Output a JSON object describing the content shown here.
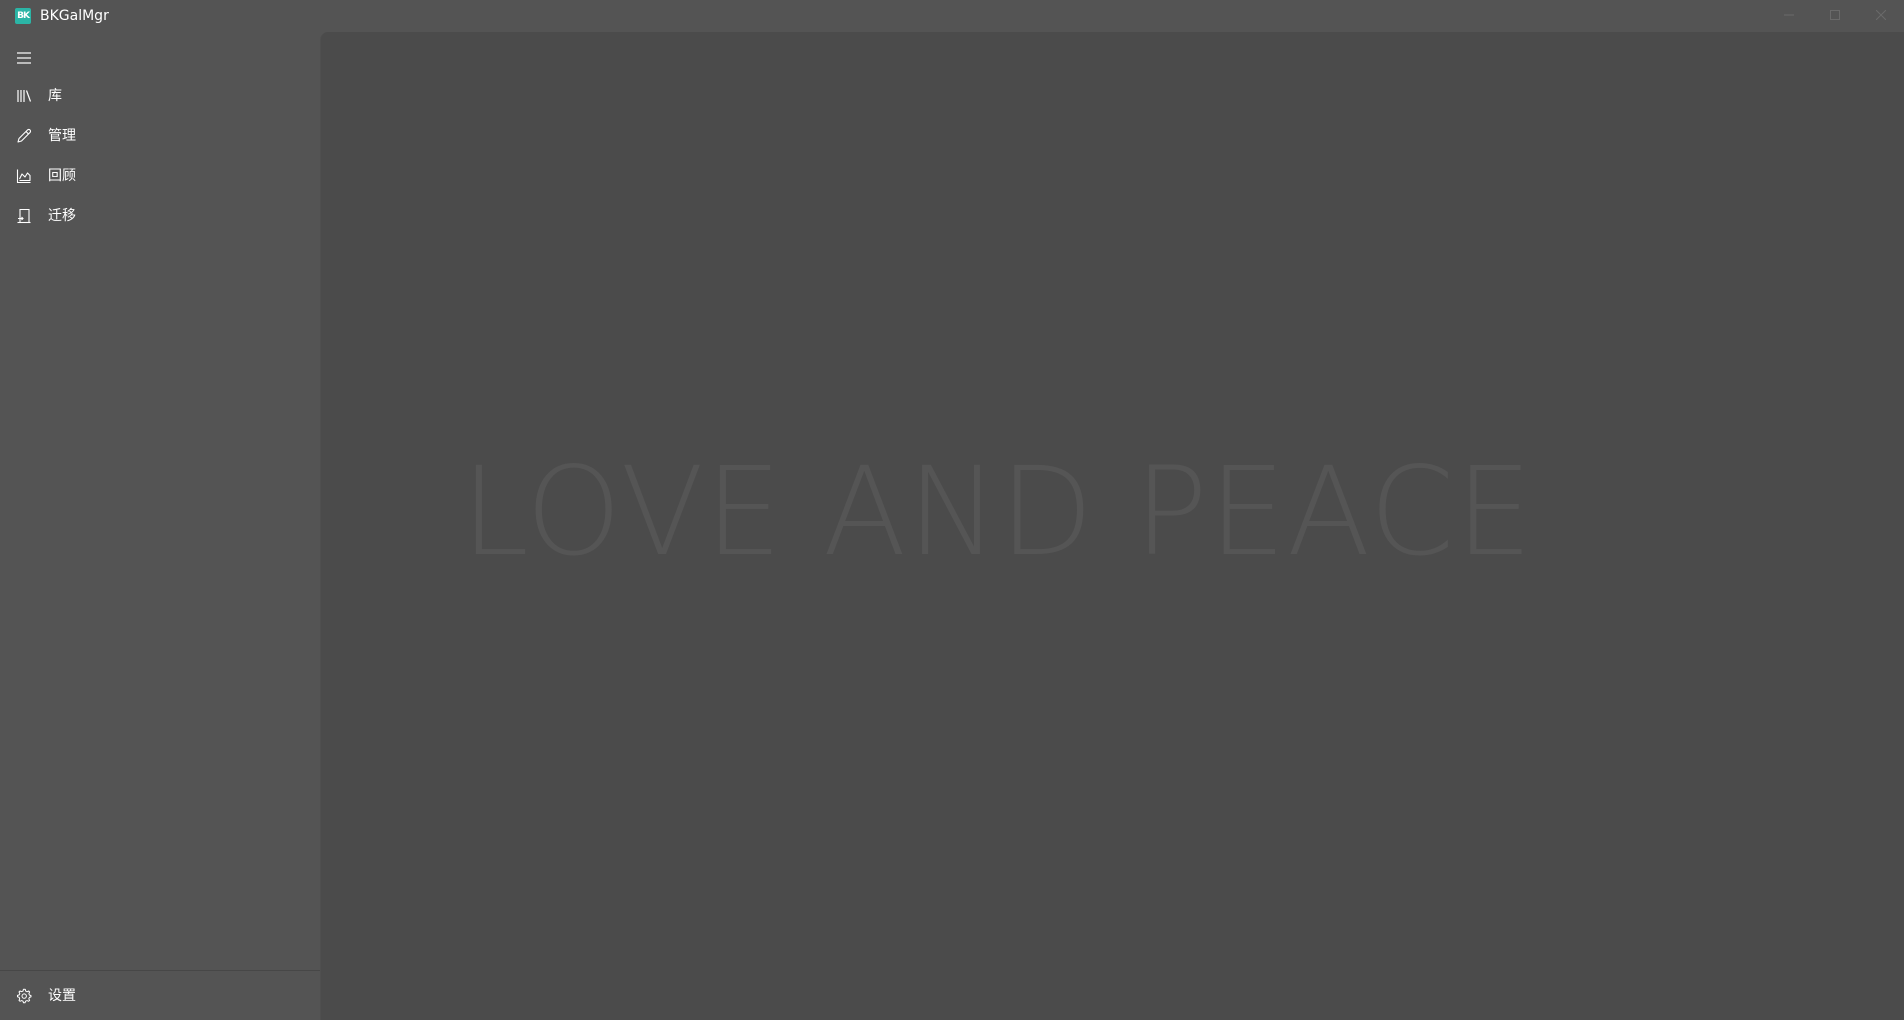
{
  "app": {
    "title": "BKGalMgr",
    "logo_text": "BK",
    "logo_color": "#2bb5a6"
  },
  "window_controls": {
    "minimize_icon": "minimize-icon",
    "maximize_icon": "maximize-icon",
    "close_icon": "close-icon"
  },
  "sidebar": {
    "toggle_icon": "hamburger-menu-icon",
    "items": [
      {
        "label": "库",
        "icon": "library-icon"
      },
      {
        "label": "管理",
        "icon": "pencil-icon"
      },
      {
        "label": "回顾",
        "icon": "area-chart-icon"
      },
      {
        "label": "迁移",
        "icon": "migrate-icon"
      }
    ],
    "footer": {
      "label": "设置",
      "icon": "gear-icon"
    }
  },
  "content": {
    "watermark": "LOVE AND PEACE"
  },
  "colors": {
    "background": "#545454",
    "content_background": "#4b4b4b",
    "watermark": "#555555",
    "text": "#ffffff"
  }
}
